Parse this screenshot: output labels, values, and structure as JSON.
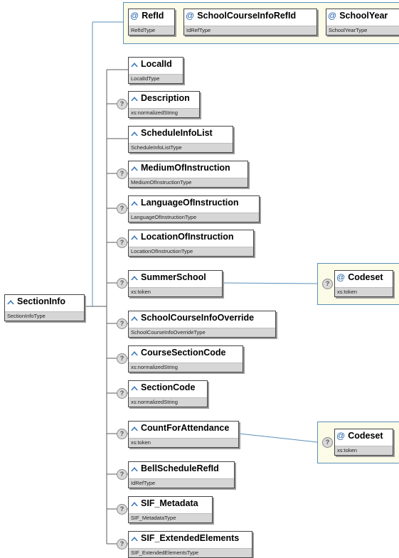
{
  "root": {
    "name": "SectionInfo",
    "type": "SectionInfoType",
    "icon": "element-icon"
  },
  "attributes": [
    {
      "name": "RefId",
      "type": "RefIdType",
      "icon": "attribute-icon"
    },
    {
      "name": "SchoolCourseInfoRefId",
      "type": "IdRefType",
      "icon": "attribute-icon"
    },
    {
      "name": "SchoolYear",
      "type": "SchoolYearType",
      "icon": "attribute-icon"
    }
  ],
  "elements": [
    {
      "name": "LocalId",
      "type": "LocalIdType",
      "optional": false
    },
    {
      "name": "Description",
      "type": "xs:normalizedString",
      "optional": true
    },
    {
      "name": "ScheduleInfoList",
      "type": "ScheduleInfoListType",
      "optional": false
    },
    {
      "name": "MediumOfInstruction",
      "type": "MediumOfInstructionType",
      "optional": true
    },
    {
      "name": "LanguageOfInstruction",
      "type": "LanguageOfInstructionType",
      "optional": true
    },
    {
      "name": "LocationOfInstruction",
      "type": "LocationOfInstructionType",
      "optional": true
    },
    {
      "name": "SummerSchool",
      "type": "xs:token",
      "optional": true,
      "child_attribute": {
        "name": "Codeset",
        "type": "xs:token",
        "optional": true
      }
    },
    {
      "name": "SchoolCourseInfoOverride",
      "type": "SchoolCourseInfoOverrideType",
      "optional": true
    },
    {
      "name": "CourseSectionCode",
      "type": "xs:normalizedString",
      "optional": true
    },
    {
      "name": "SectionCode",
      "type": "xs:normalizedString",
      "optional": true
    },
    {
      "name": "CountForAttendance",
      "type": "xs:token",
      "optional": true,
      "child_attribute": {
        "name": "Codeset",
        "type": "xs:token",
        "optional": true
      }
    },
    {
      "name": "BellScheduleRefId",
      "type": "IdRefType",
      "optional": true
    },
    {
      "name": "SIF_Metadata",
      "type": "SIF_MetadataType",
      "optional": true
    },
    {
      "name": "SIF_ExtendedElements",
      "type": "SIF_ExtendedElementsType",
      "optional": true
    }
  ],
  "colors": {
    "wire": "#5b8fb9",
    "attr_bg": "#fbfbe8",
    "type_bg": "#d6d6d6",
    "attr_icon": "#1f5fa8",
    "elem_icon": "#3b78b9"
  }
}
